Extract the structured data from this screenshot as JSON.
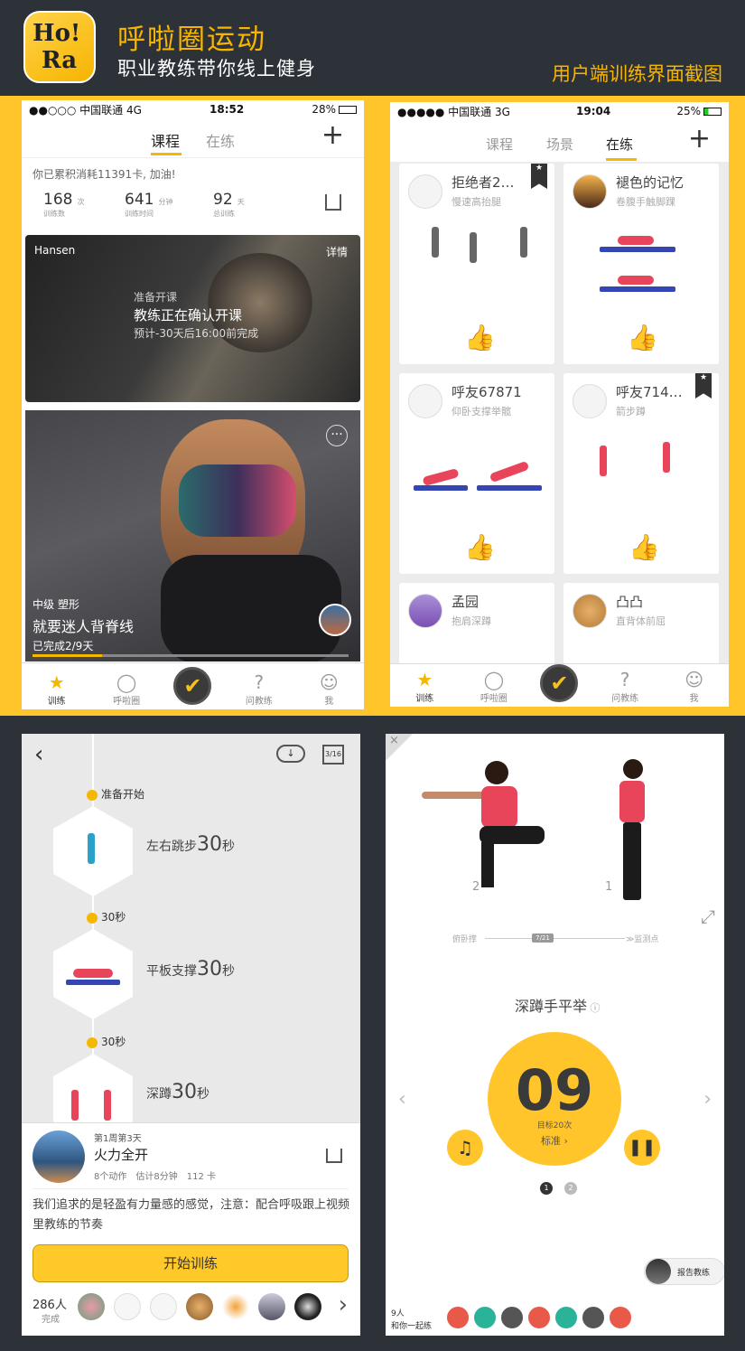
{
  "header": {
    "logo_text_1": "Ho!",
    "logo_text_2": "Ra",
    "title": "呼啦圈运动",
    "subtitle": "职业教练带你线上健身",
    "caption": "用户端训练界面截图"
  },
  "colors": {
    "accent": "#ffc52a",
    "brand_dark": "#2d3138",
    "blue_mat": "#3346b4"
  },
  "screen1": {
    "status": {
      "carrier": "●●○○○ 中国联通  4G",
      "time": "18:52",
      "battery": "28%"
    },
    "tabs": [
      "课程",
      "在练"
    ],
    "active_tab": "课程",
    "add_icon": "plus-icon",
    "notice": "你已累积消耗11391卡, 加油!",
    "stats": [
      {
        "value": "168",
        "unit": "次",
        "label": "训练数"
      },
      {
        "value": "641",
        "unit": "分钟",
        "label": "训练时间"
      },
      {
        "value": "92",
        "unit": "天",
        "label": "总训练"
      }
    ],
    "course_card": {
      "coach": "Hansen",
      "detail": "详情",
      "pre": "准备开课",
      "title": "教练正在确认开课",
      "note": "预计-30天后16:00前完成"
    },
    "program_card": {
      "level": "中级 塑形",
      "title": "就要迷人背脊线",
      "progress_text": "已完成2/9天",
      "progress": 0.22
    },
    "tabbar": [
      "训练",
      "呼啦圈",
      "",
      "问教练",
      "我"
    ]
  },
  "screen2": {
    "status": {
      "carrier": "●●●●● 中国联通  3G",
      "time": "19:04",
      "battery": "25%"
    },
    "tabs": [
      "课程",
      "场景",
      "在练"
    ],
    "active_tab": "在练",
    "cards": [
      {
        "name": "拒绝者2…",
        "sub": "慢速高抬腿",
        "liked": true
      },
      {
        "name": "褪色的记忆",
        "sub": "卷腹手触脚踝",
        "liked": false
      },
      {
        "name": "呼友67871",
        "sub": "仰卧支撑举髋",
        "liked": true
      },
      {
        "name": "呼友714…",
        "sub": "箭步蹲",
        "liked": true
      },
      {
        "name": "孟园",
        "sub": "抱肩深蹲"
      },
      {
        "name": "凸凸",
        "sub": "直背体前屈"
      }
    ],
    "tabbar": [
      "训练",
      "呼啦圈",
      "",
      "问教练",
      "我"
    ]
  },
  "screen3": {
    "date_badge": "3/16",
    "steps": [
      {
        "marker": "准备开始",
        "name": "左右跳步",
        "dur": "30",
        "unit": "秒"
      },
      {
        "marker": "30秒",
        "name": "平板支撑",
        "dur": "30",
        "unit": "秒"
      },
      {
        "marker": "30秒",
        "name": "深蹲",
        "dur": "30",
        "unit": "秒"
      }
    ],
    "plan": {
      "week": "第1周第3天",
      "title": "火力全开",
      "meta1": "8个动作",
      "meta2": "估计8分钟",
      "meta3": "112 卡"
    },
    "desc": "我们追求的是轻盈有力量感的感觉，注意：配合呼吸跟上视频里教练的节奏",
    "start_btn": "开始训练",
    "people_count": "286人",
    "people_label": "完成"
  },
  "screen4": {
    "frame_labels": [
      "2",
      "1"
    ],
    "timeline_left": "俯卧撑",
    "timeline_mid": "7/21",
    "timeline_right": "≫监测点",
    "exercise": "深蹲手平举",
    "counter": "09",
    "target": "目标20次",
    "standard": "标准",
    "pages": [
      "1",
      "2"
    ],
    "report": "报告教练",
    "together_count": "9人",
    "together_label": "和你一起练"
  }
}
